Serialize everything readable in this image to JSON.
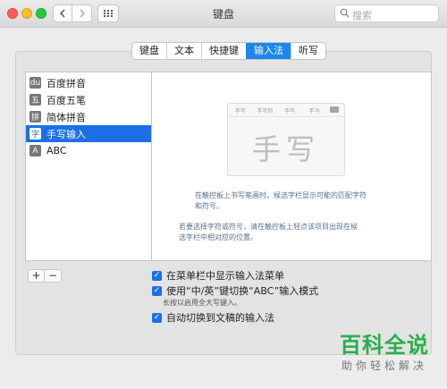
{
  "window": {
    "title": "键盘"
  },
  "toolbar": {
    "search_placeholder": "搜索"
  },
  "tabs": [
    {
      "label": "键盘",
      "selected": false
    },
    {
      "label": "文本",
      "selected": false
    },
    {
      "label": "快捷键",
      "selected": false
    },
    {
      "label": "输入法",
      "selected": true
    },
    {
      "label": "听写",
      "selected": false
    }
  ],
  "sources": [
    {
      "label": "百度拼音",
      "icon": "du",
      "selected": false
    },
    {
      "label": "百度五笔",
      "icon": "五",
      "selected": false
    },
    {
      "label": "简体拼音",
      "icon": "拼",
      "selected": false
    },
    {
      "label": "手写输入",
      "icon": "字",
      "selected": true
    },
    {
      "label": "ABC",
      "icon": "A",
      "selected": false
    }
  ],
  "handwriting": {
    "candidates": [
      "手写",
      "手写的",
      "手鸟",
      "手马"
    ],
    "sample": "手写",
    "desc1_line1": "在触控板上书写笔画时，候选字栏显示可能的匹配字符",
    "desc1_line2": "和符号。",
    "desc2_line1": "若要选择字符或符号，请在触控板上轻点该项目出现在候",
    "desc2_line2": "选字栏中相对应的位置。"
  },
  "buttons": {
    "add": "+",
    "remove": "−"
  },
  "options": {
    "show_menu": "在菜单栏中显示输入法菜单",
    "toggle_key": "使用“中/英”键切换“ABC”输入模式",
    "toggle_note": "长按以启用全大写键入。",
    "auto_switch": "自动切换到文稿的输入法"
  },
  "watermark": {
    "main": "百科全说",
    "sub": "助你轻松解决"
  },
  "colors": {
    "accent": "#1c6fe6",
    "tab_selected": "#1c86ee",
    "watermark": "#2aae4a"
  }
}
